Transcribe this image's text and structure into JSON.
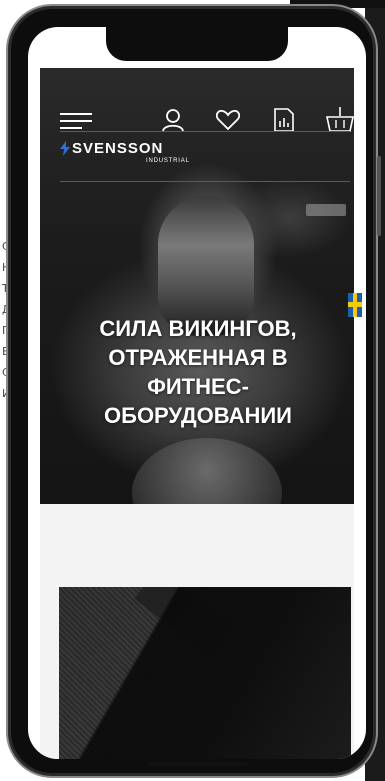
{
  "header": {
    "menu_icon": "hamburger-menu-icon",
    "account_icon": "user-icon",
    "wishlist_icon": "heart-icon",
    "compare_icon": "chart-document-icon",
    "cart_icon": "basket-icon"
  },
  "brand": {
    "name": "SVENSSON",
    "tagline": "INDUSTRIAL"
  },
  "hero": {
    "title": "СИЛА ВИКИНГОВ, ОТРАЖЕННАЯ В ФИТНЕС-ОБОРУДОВАНИИ"
  },
  "background_page": {
    "side_letters": [
      "С",
      "Н",
      "Т",
      "Д",
      "Г",
      "Е",
      "С",
      "И"
    ]
  },
  "colors": {
    "hero_bg": "#1a1a1a",
    "text_on_dark": "#ffffff",
    "section_bg": "#f3f3f3",
    "flag_blue": "#1d5ea8",
    "flag_yellow": "#f2c811"
  }
}
